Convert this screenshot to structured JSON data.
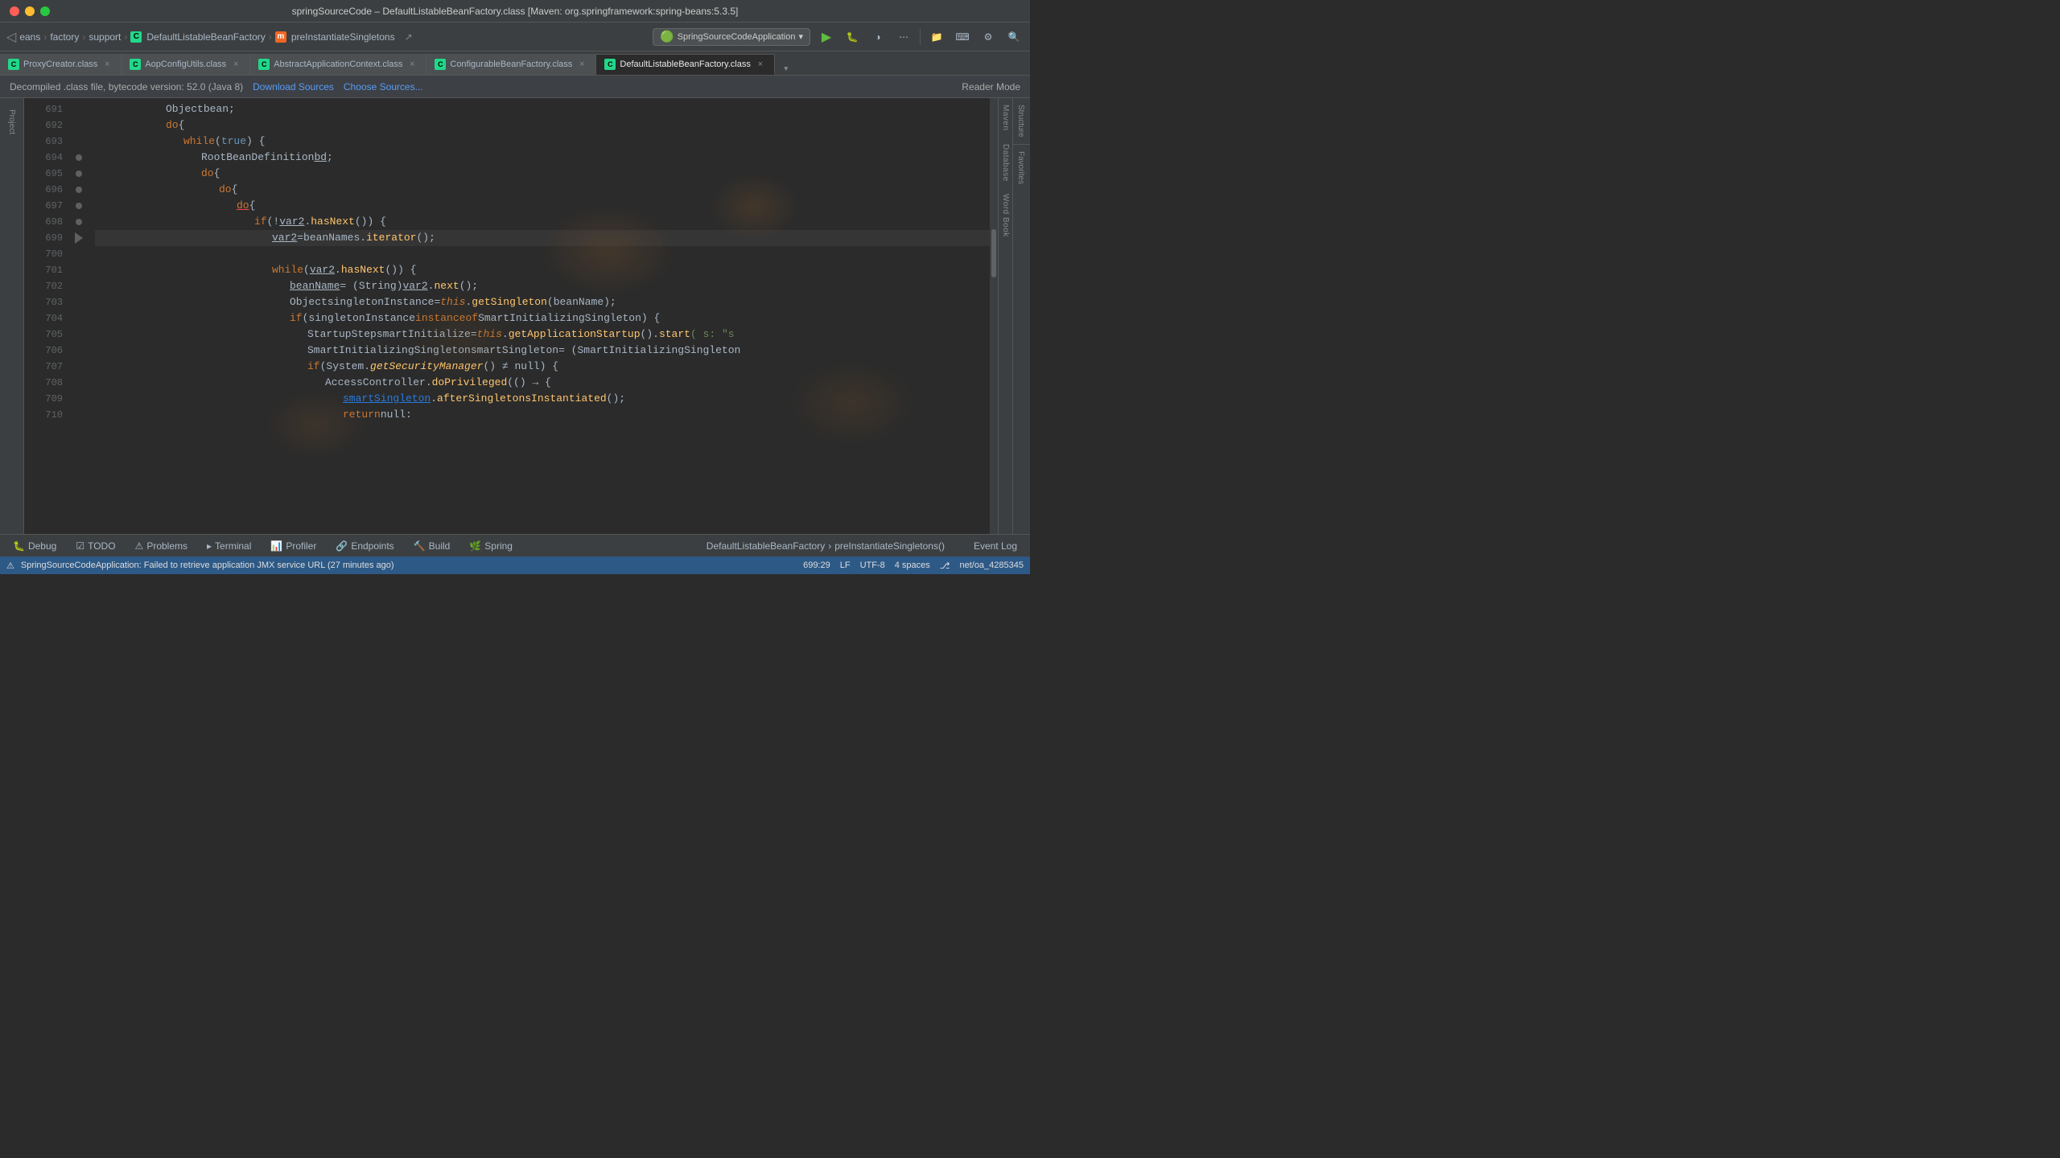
{
  "titleBar": {
    "title": "springSourceCode – DefaultListableBeanFactory.class [Maven: org.springframework:spring-beans:5.3.5]",
    "closeLabel": "×",
    "minLabel": "–",
    "maxLabel": "+"
  },
  "navBar": {
    "breadcrumbs": [
      {
        "label": "eans",
        "icon": null
      },
      {
        "label": "factory",
        "icon": null
      },
      {
        "label": "support",
        "icon": null
      },
      {
        "label": "DefaultListableBeanFactory",
        "icon": "C"
      },
      {
        "label": "preInstantiateSingletons",
        "icon": "m"
      }
    ],
    "appSelector": "SpringSourceCodeApplication",
    "runBtn": "▶",
    "debugBtn": "🐛"
  },
  "tabs": [
    {
      "label": "ProxyCreator.class",
      "icon": "C",
      "active": false
    },
    {
      "label": "AopConfigUtils.class",
      "icon": "C",
      "active": false
    },
    {
      "label": "AbstractApplicationContext.class",
      "icon": "C",
      "active": false
    },
    {
      "label": "ConfigurableBeanFactory.class",
      "icon": "C",
      "active": false
    },
    {
      "label": "DefaultListableBeanFactory.class",
      "icon": "C",
      "active": true
    }
  ],
  "infoBar": {
    "text": "Decompiled .class file, bytecode version: 52.0 (Java 8)",
    "downloadSources": "Download Sources",
    "chooseSources": "Choose Sources...",
    "readerMode": "Reader Mode"
  },
  "code": {
    "startLine": 691,
    "lines": [
      {
        "num": "691",
        "indent": 12,
        "tokens": [
          {
            "t": "Object ",
            "c": "type"
          },
          {
            "t": "bean",
            "c": "var"
          },
          {
            "t": ";",
            "c": "punct"
          }
        ]
      },
      {
        "num": "692",
        "indent": 12,
        "tokens": [
          {
            "t": "do",
            "c": "kw"
          },
          {
            "t": " {",
            "c": "punct"
          }
        ]
      },
      {
        "num": "693",
        "indent": 16,
        "tokens": [
          {
            "t": "while",
            "c": "kw"
          },
          {
            "t": "(",
            "c": "punct"
          },
          {
            "t": "true",
            "c": "true-val"
          },
          {
            "t": ") {",
            "c": "punct"
          }
        ]
      },
      {
        "num": "694",
        "indent": 20,
        "tokens": [
          {
            "t": "RootBeanDefinition ",
            "c": "type"
          },
          {
            "t": "bd",
            "c": "var-ul"
          },
          {
            "t": ";",
            "c": "punct"
          }
        ]
      },
      {
        "num": "695",
        "indent": 20,
        "tokens": [
          {
            "t": "do",
            "c": "kw"
          },
          {
            "t": " {",
            "c": "punct"
          }
        ]
      },
      {
        "num": "696",
        "indent": 24,
        "tokens": [
          {
            "t": "do",
            "c": "kw"
          },
          {
            "t": " {",
            "c": "punct"
          }
        ]
      },
      {
        "num": "697",
        "indent": 28,
        "tokens": [
          {
            "t": "do",
            "c": "kw-underline"
          },
          {
            "t": " {",
            "c": "punct"
          }
        ],
        "underline": true
      },
      {
        "num": "698",
        "indent": 32,
        "tokens": [
          {
            "t": "if",
            "c": "kw"
          },
          {
            "t": " (!",
            "c": "punct"
          },
          {
            "t": "var2",
            "c": "var-ul"
          },
          {
            "t": ".",
            "c": "punct"
          },
          {
            "t": "hasNext",
            "c": "method"
          },
          {
            "t": "()) {",
            "c": "punct"
          }
        ]
      },
      {
        "num": "699",
        "indent": 36,
        "tokens": [
          {
            "t": "var2",
            "c": "var-ul"
          },
          {
            "t": " = ",
            "c": "punct"
          },
          {
            "t": "beanNames",
            "c": "var"
          },
          {
            "t": ".",
            "c": "punct"
          },
          {
            "t": "iterator",
            "c": "method"
          },
          {
            "t": "();",
            "c": "punct"
          }
        ],
        "active": true
      },
      {
        "num": "700",
        "indent": 0,
        "tokens": []
      },
      {
        "num": "701",
        "indent": 36,
        "tokens": [
          {
            "t": "while",
            "c": "kw"
          },
          {
            "t": "(",
            "c": "punct"
          },
          {
            "t": "var2",
            "c": "var-ul"
          },
          {
            "t": ".",
            "c": "punct"
          },
          {
            "t": "hasNext",
            "c": "method"
          },
          {
            "t": "()) {",
            "c": "punct"
          }
        ]
      },
      {
        "num": "702",
        "indent": 40,
        "tokens": [
          {
            "t": "beanName",
            "c": "var-ul"
          },
          {
            "t": " = (String)",
            "c": "punct"
          },
          {
            "t": "var2",
            "c": "var-ul"
          },
          {
            "t": ".",
            "c": "punct"
          },
          {
            "t": "next",
            "c": "method"
          },
          {
            "t": "();",
            "c": "punct"
          }
        ]
      },
      {
        "num": "703",
        "indent": 40,
        "tokens": [
          {
            "t": "Object ",
            "c": "type"
          },
          {
            "t": "singletonInstance",
            "c": "var"
          },
          {
            "t": " = ",
            "c": "punct"
          },
          {
            "t": "this",
            "c": "this-kw"
          },
          {
            "t": ".",
            "c": "punct"
          },
          {
            "t": "getSingleton",
            "c": "method"
          },
          {
            "t": "(beanName);",
            "c": "punct"
          }
        ]
      },
      {
        "num": "704",
        "indent": 40,
        "tokens": [
          {
            "t": "if",
            "c": "kw"
          },
          {
            "t": " (singletonInstance ",
            "c": "punct"
          },
          {
            "t": "instanceof",
            "c": "kw"
          },
          {
            "t": " SmartInitializingSingleton) {",
            "c": "type"
          }
        ]
      },
      {
        "num": "705",
        "indent": 44,
        "tokens": [
          {
            "t": "StartupStep ",
            "c": "type"
          },
          {
            "t": "smartInitialize",
            "c": "var"
          },
          {
            "t": " = ",
            "c": "punct"
          },
          {
            "t": "this",
            "c": "this-kw"
          },
          {
            "t": ".",
            "c": "punct"
          },
          {
            "t": "getApplicationStartup",
            "c": "method"
          },
          {
            "t": "().",
            "c": "punct"
          },
          {
            "t": "start",
            "c": "method"
          },
          {
            "t": "( s: \"s",
            "c": "str"
          }
        ]
      },
      {
        "num": "706",
        "indent": 44,
        "tokens": [
          {
            "t": "SmartInitializingSingleton ",
            "c": "type"
          },
          {
            "t": "smartSingleton",
            "c": "var"
          },
          {
            "t": " = (SmartInitializingSingleton",
            "c": "punct"
          }
        ]
      },
      {
        "num": "707",
        "indent": 44,
        "tokens": [
          {
            "t": "if",
            "c": "kw"
          },
          {
            "t": " (System.",
            "c": "punct"
          },
          {
            "t": "getSecurityManager",
            "c": "method-italic"
          },
          {
            "t": "() ≠ null) {",
            "c": "punct"
          }
        ]
      },
      {
        "num": "708",
        "indent": 48,
        "tokens": [
          {
            "t": "AccessController.",
            "c": "type"
          },
          {
            "t": "doPrivileged",
            "c": "method"
          },
          {
            "t": "(() → {",
            "c": "punct"
          }
        ]
      },
      {
        "num": "709",
        "indent": 52,
        "tokens": [
          {
            "t": "smartSingleton",
            "c": "link-text"
          },
          {
            "t": ".",
            "c": "punct"
          },
          {
            "t": "afterSingletonsInstantiated",
            "c": "method"
          },
          {
            "t": "();",
            "c": "punct"
          }
        ]
      },
      {
        "num": "710",
        "indent": 52,
        "tokens": [
          {
            "t": "return null:",
            "c": "var"
          }
        ]
      }
    ]
  },
  "bottomBar": {
    "breadcrumb1": "DefaultListableBeanFactory",
    "breadcrumb2": "preInstantiateSingletons()",
    "debugBtn": "Debug",
    "todoBtn": "TODO",
    "problemsBtn": "Problems",
    "terminalBtn": "Terminal",
    "profilerBtn": "Profiler",
    "endpointsBtn": "Endpoints",
    "buildBtn": "Build",
    "springBtn": "Spring",
    "eventLogBtn": "Event Log"
  },
  "statusBar": {
    "text": "SpringSourceCodeApplication: Failed to retrieve application JMX service URL (27 minutes ago)",
    "position": "699:29",
    "lineEnding": "LF",
    "encoding": "UTF-8",
    "indent": "4 spaces"
  },
  "rightPanels": [
    "Maven",
    "Database",
    "Word Book"
  ],
  "leftPanels": [
    "Project"
  ],
  "structurePanel": "Structure",
  "favoritesPanel": "Favorites"
}
